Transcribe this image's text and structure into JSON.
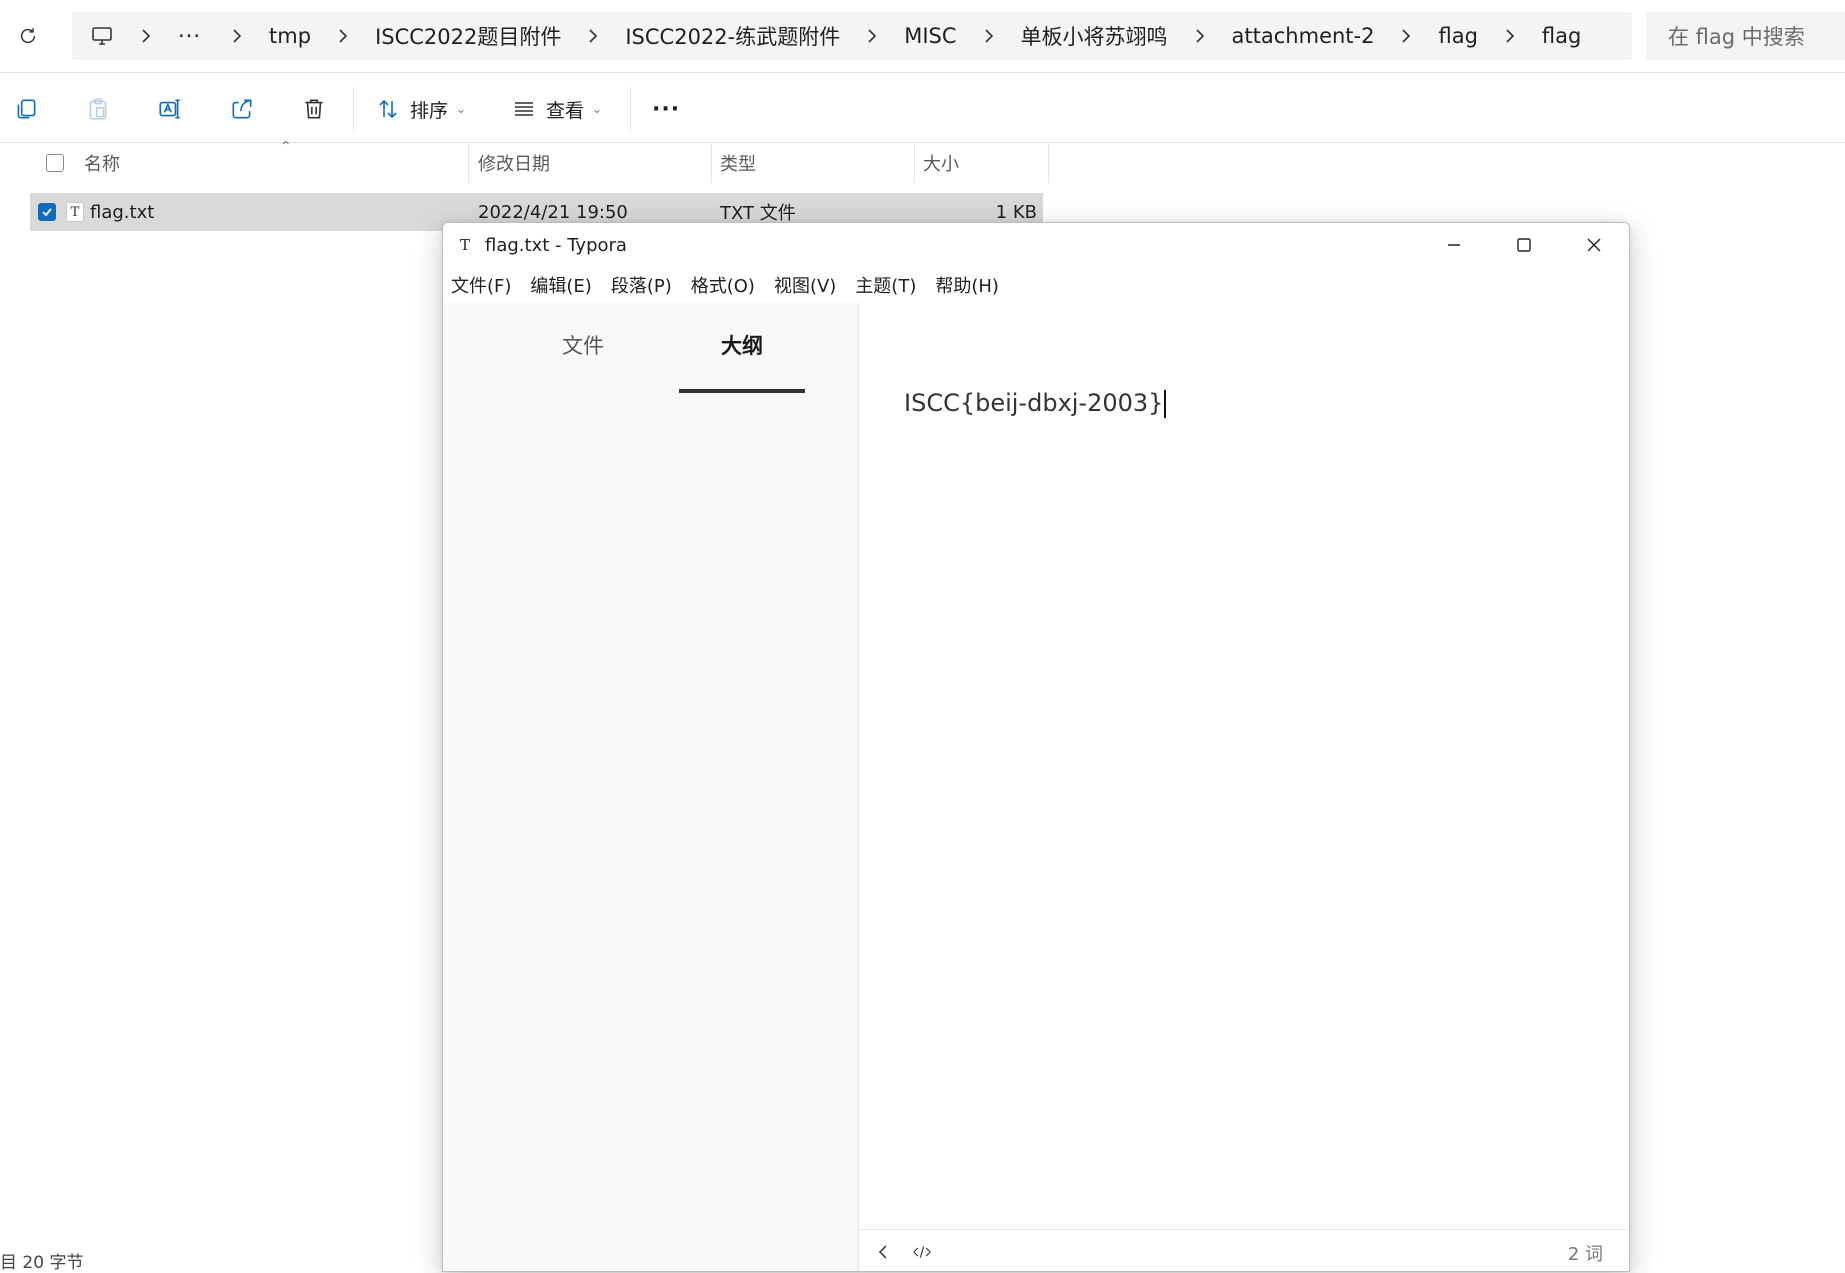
{
  "breadcrumb": {
    "items": [
      "tmp",
      "ISCC2022题目附件",
      "ISCC2022-练武题附件",
      "MISC",
      "单板小将苏翊鸣",
      "attachment-2",
      "flag",
      "flag"
    ],
    "more": "···"
  },
  "search": {
    "placeholder": "在 flag 中搜索"
  },
  "toolbar": {
    "sort_label": "排序",
    "view_label": "查看",
    "more_label": "···"
  },
  "columns": {
    "name": "名称",
    "modified": "修改日期",
    "type": "类型",
    "size": "大小"
  },
  "files": [
    {
      "name": "flag.txt",
      "modified": "2022/4/21 19:50",
      "type": "TXT 文件",
      "size": "1 KB",
      "selected": true
    }
  ],
  "status_bar": {
    "left_text": "目 20 字节"
  },
  "typora": {
    "title": "flag.txt - Typora",
    "menus": [
      "文件(F)",
      "编辑(E)",
      "段落(P)",
      "格式(O)",
      "视图(V)",
      "主题(T)",
      "帮助(H)"
    ],
    "tabs": {
      "files": "文件",
      "outline": "大纲",
      "active": "outline"
    },
    "content": "ISCC{beij-dbxj-2003}",
    "word_count": "2 词"
  },
  "colors": {
    "accent": "#0f6cbd",
    "selected_row": "#d9d9d9",
    "sidebar_bg": "#f8f8f8"
  },
  "icons": [
    "refresh-icon",
    "computer-icon",
    "chevron-right-icon",
    "copy-icon",
    "paste-icon",
    "rename-icon",
    "share-icon",
    "delete-icon",
    "sort-icon",
    "view-icon",
    "more-icon",
    "minimize-icon",
    "maximize-icon",
    "close-icon",
    "back-icon",
    "source-code-icon"
  ]
}
